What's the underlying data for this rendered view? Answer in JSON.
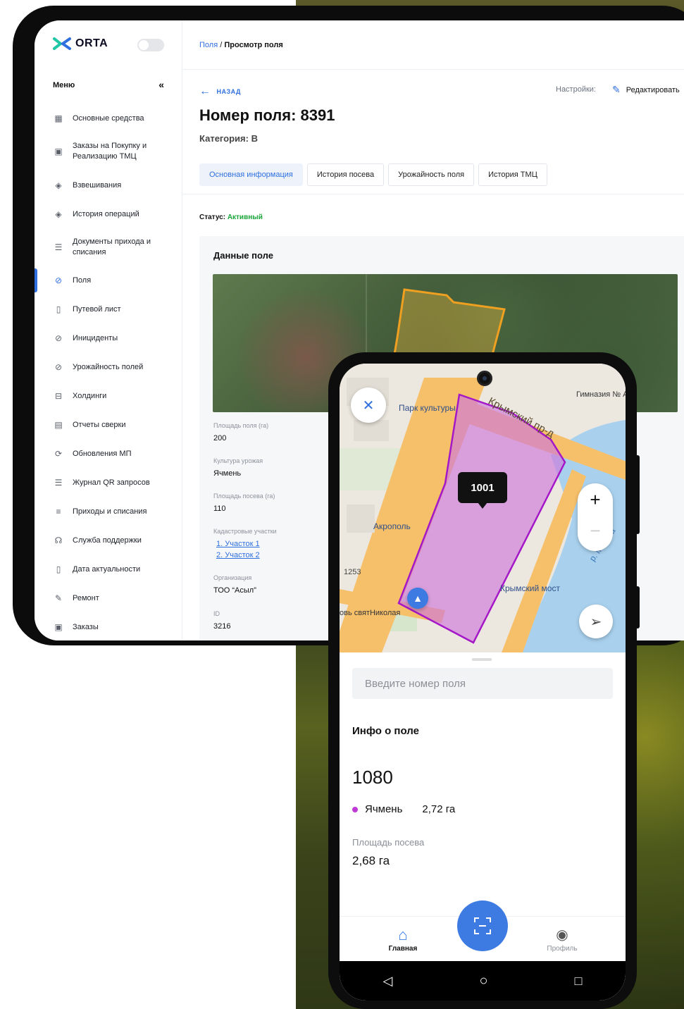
{
  "app": {
    "logo": "ORTA"
  },
  "sidebar": {
    "title": "Меню",
    "items": [
      "Основные средства",
      "Заказы на Покупку и Реализацию ТМЦ",
      "Взвешивания",
      "История операций",
      "Документы прихода и списания",
      "Поля",
      "Путевой лист",
      "Инициденты",
      "Урожайность полей",
      "Холдинги",
      "Отчеты сверки",
      "Обновления МП",
      "Журнал QR запросов",
      "Приходы и списания",
      "Служба поддержки",
      "Дата актуальности",
      "Ремонт",
      "Заказы"
    ]
  },
  "breadcrumb": {
    "parent": "Поля",
    "current": "Просмотр поля"
  },
  "page": {
    "back": "НАЗАД",
    "settings": "Настройки:",
    "edit": "Редактировать",
    "title": "Номер поля: 8391",
    "category": "Категория: B",
    "status_label": "Статус:",
    "status_value": "Активный",
    "card_title": "Данные поле"
  },
  "tabs": [
    "Основная информация",
    "История посева",
    "Урожайность поля",
    "История ТМЦ"
  ],
  "props": {
    "area_label": "Площадь поля (га)",
    "area_value": "200",
    "crop_label": "Культура урожая",
    "crop_value": "Ячмень",
    "sown_label": "Площадь посева (га)",
    "sown_value": "110",
    "cadastral_label": "Кадастровые участки",
    "cadastral": [
      "1. Участок 1",
      "2. Участок 2"
    ],
    "org_label": "Организация",
    "org_value": "ТОО “Асыл”",
    "id_label": "ID",
    "id_value": "3216"
  },
  "map": {
    "tooltip": "1001",
    "labels": [
      "Парк культуры",
      "Гимназия № А. С. Гри",
      "Акрополь",
      "Крымский мост",
      "овь святНиколая",
      "Крымский пр-д",
      "р. Москва",
      "1253"
    ]
  },
  "sheet": {
    "placeholder": "Введите номер поля",
    "info_title": "Инфо о поле",
    "field_number": "1080",
    "crop": "Ячмень",
    "area": "2,72 га",
    "sown_label": "Площадь посева",
    "sown_value": "2,68 га"
  },
  "nav": {
    "home": "Главная",
    "profile": "Профиль"
  },
  "colors": {
    "accent": "#2f6fde",
    "active_status": "#1aa53a",
    "field_polygon": "#a418c8",
    "fab": "#3d7be3"
  }
}
